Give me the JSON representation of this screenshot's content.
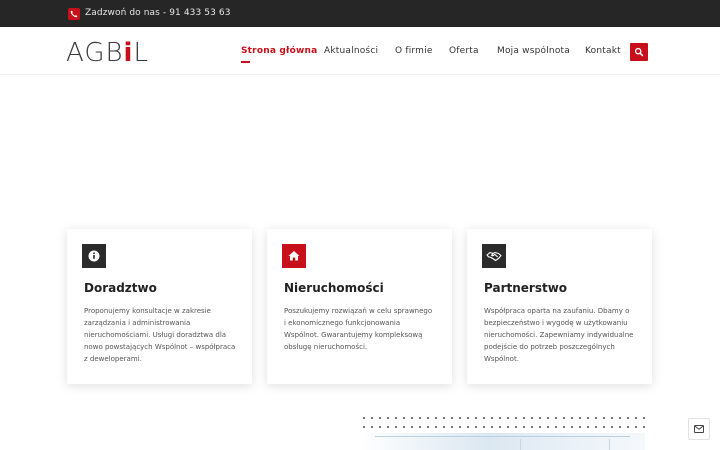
{
  "topbar": {
    "phone_icon": "phone-icon",
    "phone_text": "Zadzwoń do nas - 91 433 53 63"
  },
  "header": {
    "logo_text_a": "AGB",
    "logo_text_accent": "i",
    "logo_text_b": "L",
    "nav": [
      {
        "label": "Strona główna",
        "active": true
      },
      {
        "label": "Aktualności",
        "active": false
      },
      {
        "label": "O firmie",
        "active": false
      },
      {
        "label": "Oferta",
        "active": false
      },
      {
        "label": "Moja wspólnota",
        "active": false
      },
      {
        "label": "Kontakt",
        "active": false
      }
    ],
    "search_icon": "search-icon"
  },
  "features": [
    {
      "icon": "info-icon",
      "title": "Doradztwo",
      "text": "Proponujemy konsultacje w zakresie zarządzania i administrowania nieruchomościami. Usługi doradztwa dla nowo powstających Wspólnot – współpraca z deweloperami."
    },
    {
      "icon": "home-icon",
      "title": "Nieruchomości",
      "text": "Poszukujemy rozwiązań w celu sprawnego i ekonomicznego funkcjonowania Wspólnot. Gwarantujemy kompleksową obsługę nieruchomości."
    },
    {
      "icon": "handshake-icon",
      "title": "Partnerstwo",
      "text": "Współpraca oparta na zaufaniu. Dbamy o bezpieczeństwo i wygodę w użytkowaniu nieruchomości. Zapewniamy indywidualne podejście do potrzeb poszczególnych Wspólnot."
    }
  ],
  "colors": {
    "accent": "#c8101a",
    "dark": "#262626",
    "badge_dark": "#2b2b2b"
  },
  "floating": {
    "message_icon": "envelope-icon"
  }
}
